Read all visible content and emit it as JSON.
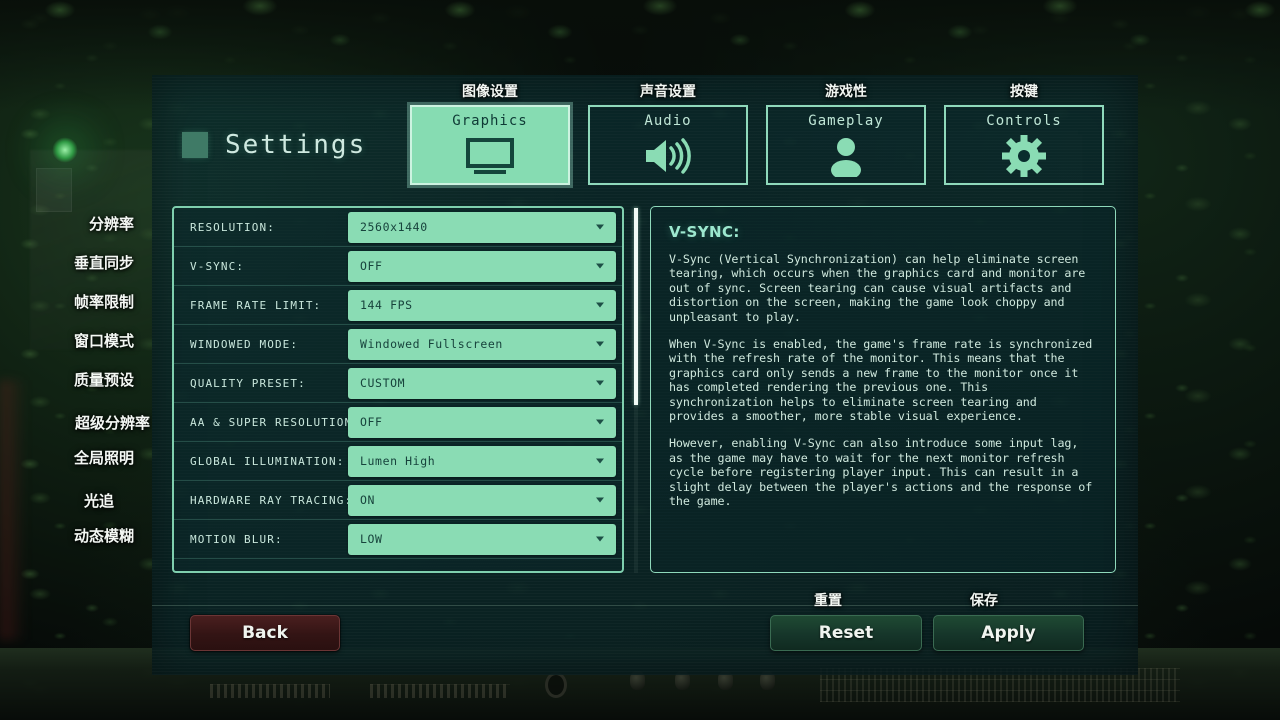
{
  "header": {
    "title": "Settings"
  },
  "tabs": [
    {
      "label": "Graphics",
      "cn": "图像设置",
      "icon": "monitor-icon",
      "active": true
    },
    {
      "label": "Audio",
      "cn": "声音设置",
      "icon": "speaker-icon",
      "active": false
    },
    {
      "label": "Gameplay",
      "cn": "游戏性",
      "icon": "person-icon",
      "active": false
    },
    {
      "label": "Controls",
      "cn": "按键",
      "icon": "gear-icon",
      "active": false
    }
  ],
  "options": [
    {
      "label": "RESOLUTION:",
      "value": "2560x1440",
      "cn": "分辨率"
    },
    {
      "label": "V-SYNC:",
      "value": "OFF",
      "cn": "垂直同步"
    },
    {
      "label": "FRAME RATE LIMIT:",
      "value": "144 FPS",
      "cn": "帧率限制"
    },
    {
      "label": "WINDOWED MODE:",
      "value": "Windowed Fullscreen",
      "cn": "窗口模式"
    },
    {
      "label": "QUALITY PRESET:",
      "value": "CUSTOM",
      "cn": "质量预设"
    },
    {
      "label": "AA & SUPER RESOLUTION:",
      "value": "OFF",
      "cn": "超级分辨率"
    },
    {
      "label": "GLOBAL ILLUMINATION:",
      "value": "Lumen High",
      "cn": "全局照明"
    },
    {
      "label": "HARDWARE RAY TRACING:",
      "value": "ON",
      "cn": "光追"
    },
    {
      "label": "MOTION BLUR:",
      "value": "LOW",
      "cn": "动态模糊"
    }
  ],
  "description": {
    "title": "V-SYNC:",
    "paragraphs": [
      "V-Sync (Vertical Synchronization) can help eliminate screen tearing, which occurs when the graphics card and monitor are out of sync. Screen tearing can cause visual artifacts and distortion on the screen, making the game look choppy and unpleasant to play.",
      "When V-Sync is enabled, the game's frame rate is synchronized with the refresh rate of the monitor. This means that the graphics card only sends a new frame to the monitor once it has completed rendering the previous one. This synchronization helps to eliminate screen tearing and provides a smoother, more stable visual experience.",
      "However, enabling V-Sync can also introduce some input lag, as the game may have to wait for the next monitor refresh cycle before registering player input. This can result in a slight delay between the player's actions and the response of the game."
    ]
  },
  "footer": {
    "back": "Back",
    "reset": "Reset",
    "apply": "Apply",
    "reset_cn": "重置",
    "apply_cn": "保存"
  },
  "colors": {
    "accent": "#8adcb4",
    "panel_bg": "#0c2e2f",
    "border": "#8fd9bb",
    "text": "#cfe8dd",
    "back_button": "#331414",
    "green_button": "#16362a"
  },
  "scroll": {
    "position_percent": 0
  }
}
